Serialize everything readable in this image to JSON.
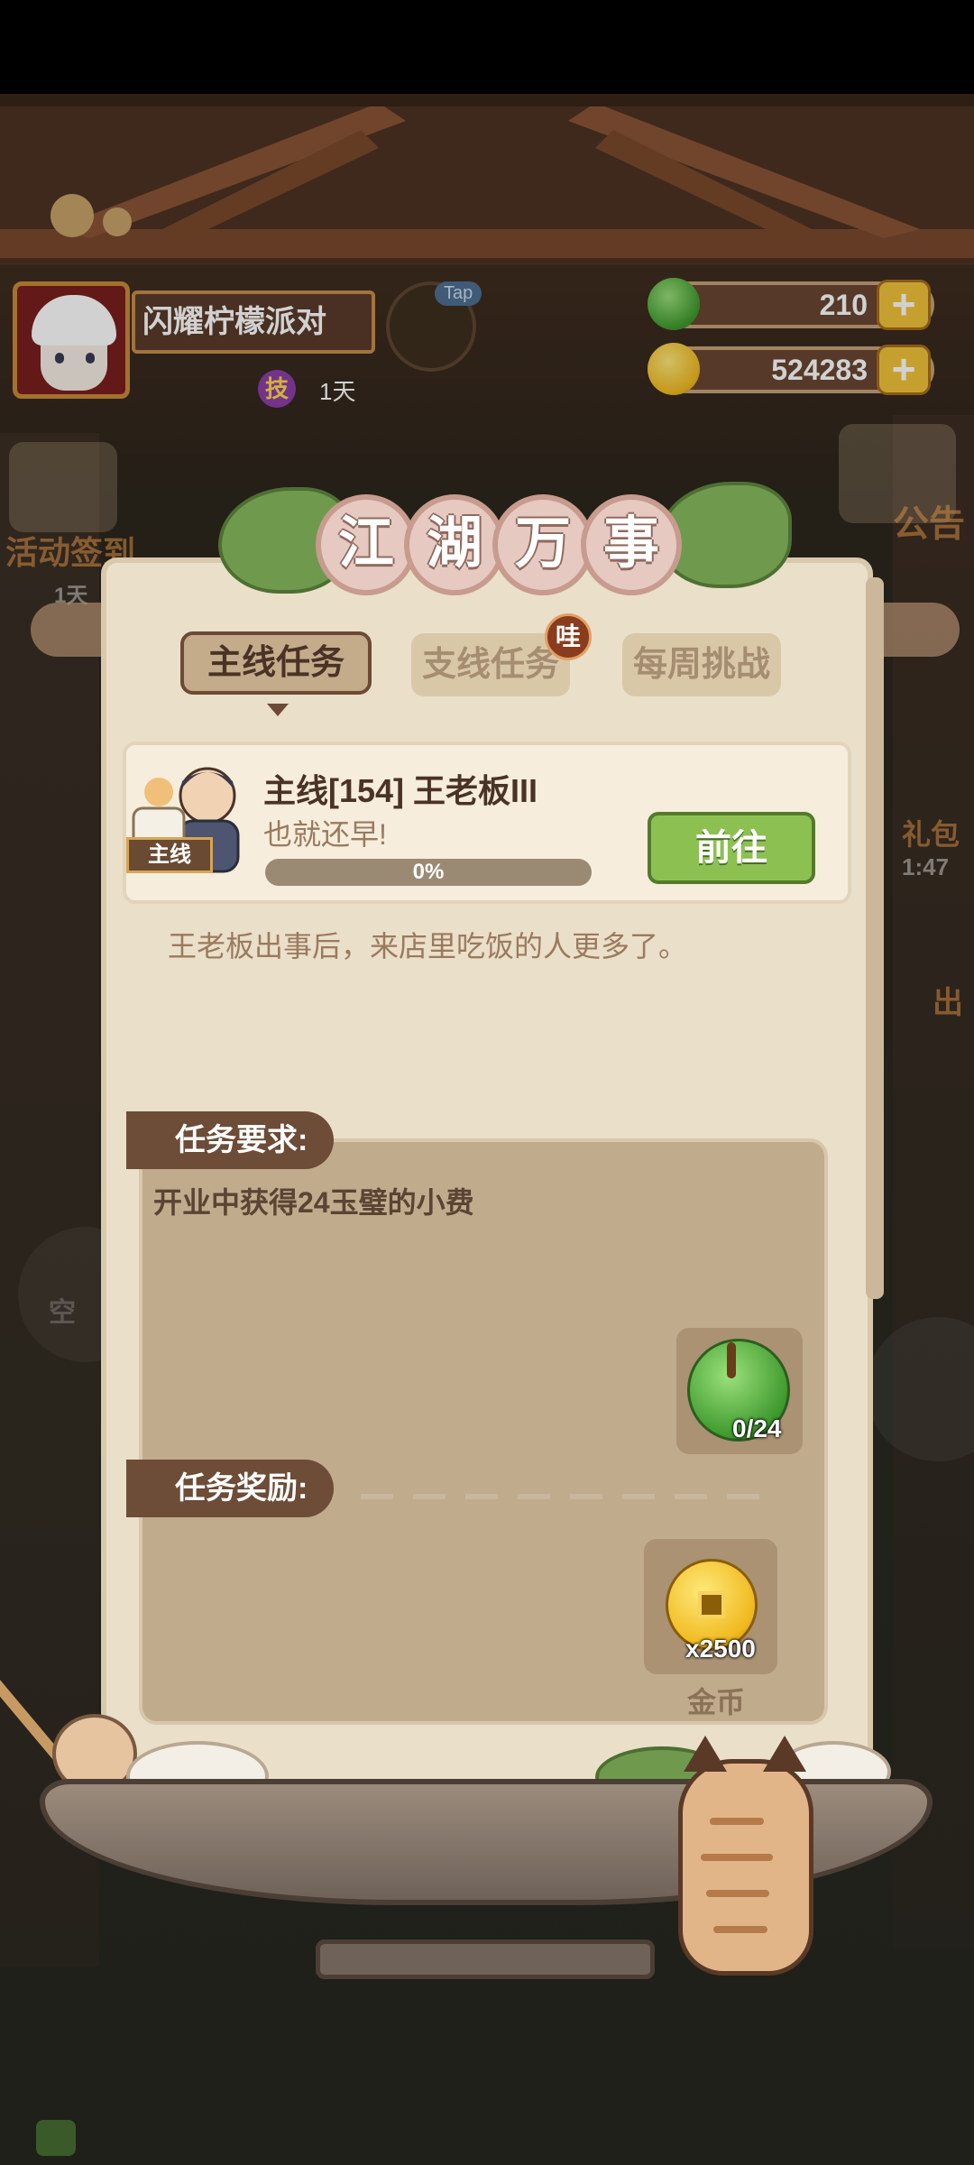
{
  "player": {
    "name": "闪耀柠檬派对",
    "skill_badge": "技",
    "skill_days": "1天"
  },
  "hud": {
    "tap_label": "Tap",
    "jade_amount": "210",
    "coin_amount": "524283",
    "plus": "+"
  },
  "background": {
    "left_label": "活动签到",
    "left_sub": "1天",
    "right_label": "公告",
    "right_timer": "1:47",
    "right_gift": "礼包",
    "right_out": "出",
    "floor_label": "空"
  },
  "dialog": {
    "title_chars": [
      "江",
      "湖",
      "万",
      "事"
    ],
    "tabs": [
      {
        "label": "主线任务",
        "active": true
      },
      {
        "label": "支线任务",
        "active": false
      },
      {
        "label": "每周挑战",
        "active": false
      }
    ],
    "tab_badge": "哇",
    "quest": {
      "type_tag": "主线",
      "title": "主线[154]  王老板III",
      "subtitle": "也就还早!",
      "progress_text": "0%",
      "progress": 0,
      "go_label": "前往",
      "description": "王老板出事后，来店里吃饭的人更多了。"
    },
    "requirements": {
      "header": "任务要求:",
      "text": "开业中获得24玉璧的小费",
      "item_count": "0/24"
    },
    "rewards": {
      "header": "任务奖励:",
      "item_count": "x2500",
      "item_name": "金币"
    }
  },
  "colors": {
    "panel": "#eadfc9",
    "accent_green": "#8cc152",
    "tag_brown": "#6d4c38"
  }
}
